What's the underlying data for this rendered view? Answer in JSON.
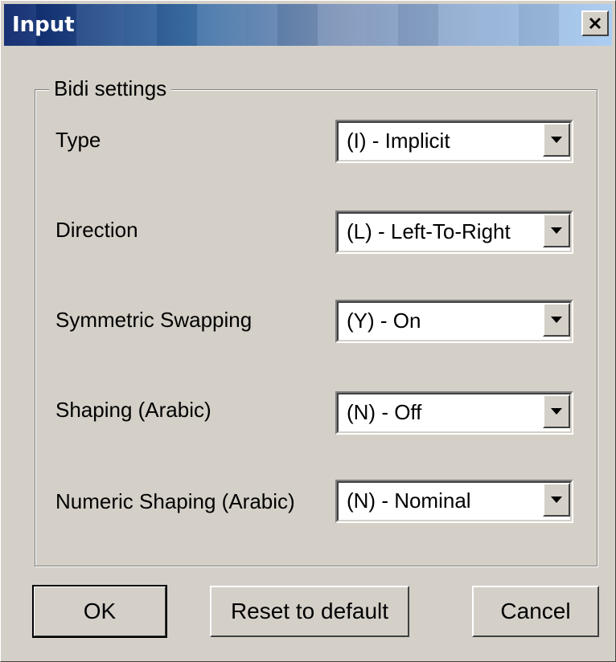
{
  "window": {
    "title": "Input"
  },
  "group": {
    "legend": "Bidi settings"
  },
  "fields": [
    {
      "label": "Type",
      "value": "(I) - Implicit"
    },
    {
      "label": "Direction",
      "value": "(L) - Left-To-Right"
    },
    {
      "label": "Symmetric Swapping",
      "value": "(Y) - On"
    },
    {
      "label": "Shaping (Arabic)",
      "value": "(N) - Off"
    },
    {
      "label": "Numeric Shaping (Arabic)",
      "value": "(N) - Nominal"
    }
  ],
  "buttons": {
    "ok": "OK",
    "reset": "Reset to default",
    "cancel": "Cancel"
  },
  "icons": {
    "close": "close-icon",
    "dropdown": "chevron-down-icon"
  },
  "colors": {
    "face": "#d4d0c8",
    "title_start": "#0a246a",
    "title_end": "#a6caf0"
  }
}
